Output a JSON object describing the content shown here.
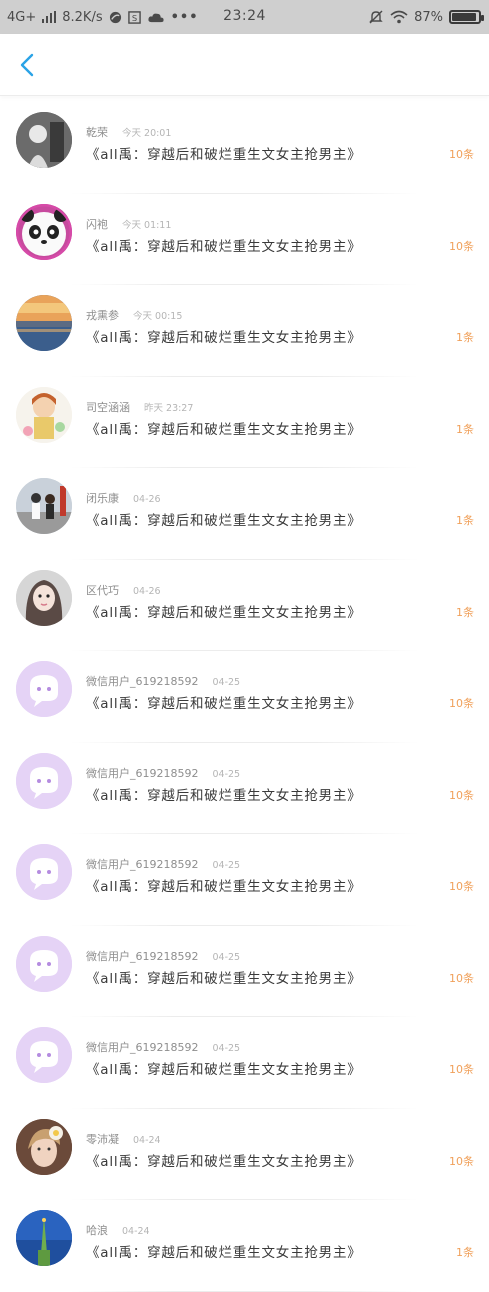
{
  "status_bar": {
    "network": "4G+",
    "speed": "8.2K/s",
    "time": "23:24",
    "battery": "87%",
    "battery_level": 0.87
  },
  "header": {
    "back_icon": "chevron-left-icon",
    "accent_color": "#2aa3e6"
  },
  "items": [
    {
      "name": "乾荣",
      "time": "今天 20:01",
      "title": "《all禹：穿越后和破烂重生文女主抢男主》",
      "count": "10条",
      "avatar": "photo-dark"
    },
    {
      "name": "闪袍",
      "time": "今天 01:11",
      "title": "《all禹：穿越后和破烂重生文女主抢男主》",
      "count": "10条",
      "avatar": "panda"
    },
    {
      "name": "戎熏参",
      "time": "今天 00:15",
      "title": "《all禹：穿越后和破烂重生文女主抢男主》",
      "count": "1条",
      "avatar": "sunset"
    },
    {
      "name": "司空涵涵",
      "time": "昨天 23:27",
      "title": "《all禹：穿越后和破烂重生文女主抢男主》",
      "count": "1条",
      "avatar": "cartoon-girl"
    },
    {
      "name": "闭乐康",
      "time": "04-26",
      "title": "《all禹：穿越后和破烂重生文女主抢男主》",
      "count": "1条",
      "avatar": "couple"
    },
    {
      "name": "区代巧",
      "time": "04-26",
      "title": "《all禹：穿越后和破烂重生文女主抢男主》",
      "count": "1条",
      "avatar": "girl"
    },
    {
      "name": "微信用户_619218592",
      "time": "04-25",
      "title": "《all禹：穿越后和破烂重生文女主抢男主》",
      "count": "10条",
      "avatar": "default"
    },
    {
      "name": "微信用户_619218592",
      "time": "04-25",
      "title": "《all禹：穿越后和破烂重生文女主抢男主》",
      "count": "10条",
      "avatar": "default"
    },
    {
      "name": "微信用户_619218592",
      "time": "04-25",
      "title": "《all禹：穿越后和破烂重生文女主抢男主》",
      "count": "10条",
      "avatar": "default"
    },
    {
      "name": "微信用户_619218592",
      "time": "04-25",
      "title": "《all禹：穿越后和破烂重生文女主抢男主》",
      "count": "10条",
      "avatar": "default"
    },
    {
      "name": "微信用户_619218592",
      "time": "04-25",
      "title": "《all禹：穿越后和破烂重生文女主抢男主》",
      "count": "10条",
      "avatar": "default"
    },
    {
      "name": "零沛凝",
      "time": "04-24",
      "title": "《all禹：穿越后和破烂重生文女主抢男主》",
      "count": "10条",
      "avatar": "flower-girl"
    },
    {
      "name": "哈浪",
      "time": "04-24",
      "title": "《all禹：穿越后和破烂重生文女主抢男主》",
      "count": "1条",
      "avatar": "tower"
    }
  ]
}
